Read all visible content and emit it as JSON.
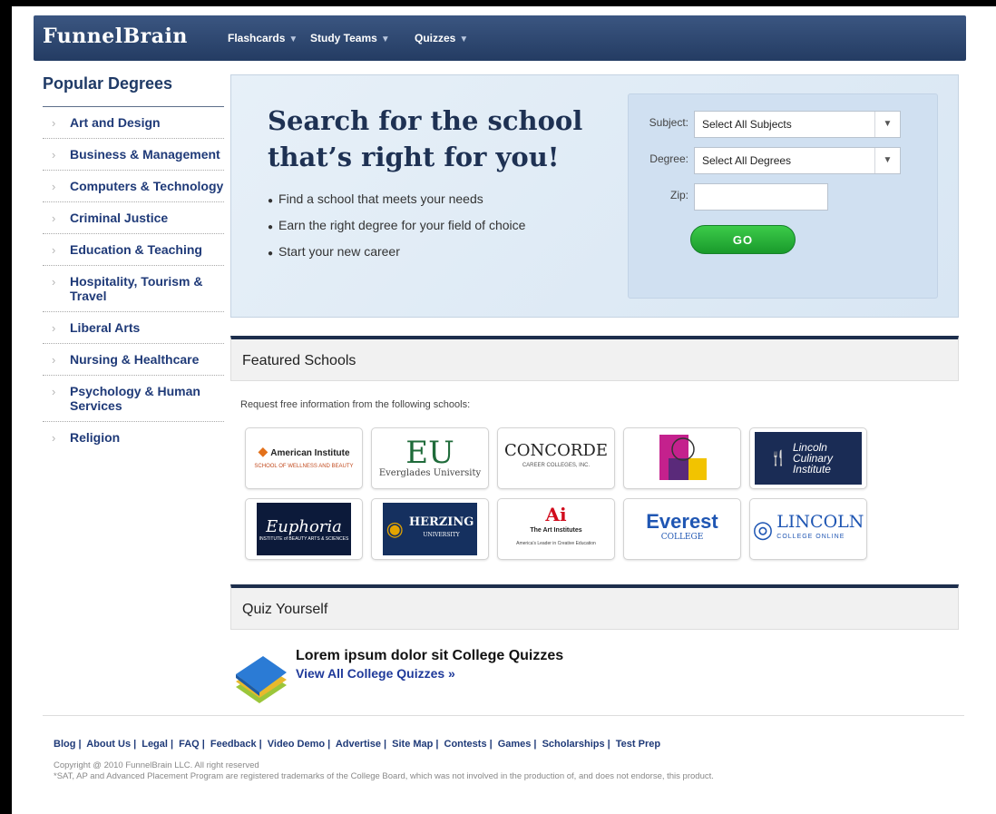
{
  "nav": {
    "brand": "FunnelBrain",
    "items": [
      "Flashcards",
      "Study Teams",
      "Quizzes"
    ]
  },
  "sidebar": {
    "title": "Popular Degrees",
    "items": [
      "Art and Design",
      "Business & Management",
      "Computers & Technology",
      "Criminal Justice",
      "Education & Teaching",
      "Hospitality, Tourism & Travel",
      "Liberal Arts",
      "Nursing & Healthcare",
      "Psychology & Human Services",
      "Religion"
    ]
  },
  "hero": {
    "headline": "Search for the school that’s right for you!",
    "bullets": [
      "Find a school that meets your needs",
      "Earn the right degree for your field of choice",
      "Start your new career"
    ],
    "subject_label": "Subject:",
    "subject_value": "Select All Subjects",
    "degree_label": "Degree:",
    "degree_value": "Select All Degrees",
    "zip_label": "Zip:",
    "zip_value": "",
    "go_label": "GO"
  },
  "featured": {
    "title": "Featured Schools",
    "request_text": "Request free information from the following schools:",
    "logos": [
      {
        "name": "American Institute",
        "line2": "SCHOOL OF WELLNESS AND BEAUTY"
      },
      {
        "name": "EU",
        "line2": "Everglades University"
      },
      {
        "name": "CONCORDE",
        "line2": "CAREER COLLEGES, INC."
      },
      {
        "name": "",
        "line2": ""
      },
      {
        "name": "Lincoln Culinary Institute",
        "line2": ""
      },
      {
        "name": "Euphoria",
        "line2": "INSTITUTE of BEAUTY ARTS & SCIENCES"
      },
      {
        "name": "HERZING",
        "line2": "UNIVERSITY"
      },
      {
        "name": "The Art Institutes",
        "line2": "America's Leader in Creative Education"
      },
      {
        "name": "Everest",
        "line2": "COLLEGE"
      },
      {
        "name": "LINCOLN",
        "line2": "COLLEGE ONLINE"
      }
    ]
  },
  "quiz": {
    "title": "Quiz Yourself",
    "headline": "Lorem ipsum dolor sit College Quizzes",
    "link": "View All College Quizzes »"
  },
  "footer": {
    "links": [
      "Blog",
      "About Us",
      "Legal",
      "FAQ",
      "Feedback",
      "Video Demo",
      "Advertise",
      "Site Map",
      "Contests",
      "Games",
      "Scholarships",
      "Test Prep"
    ],
    "copyright": "Copyright @ 2010 FunnelBrain LLC. All right reserved",
    "disclaimer": "*SAT, AP and Advanced Placement Program are registered trademarks of the College Board, which was not involved in the production of, and does not endorse, this product."
  }
}
